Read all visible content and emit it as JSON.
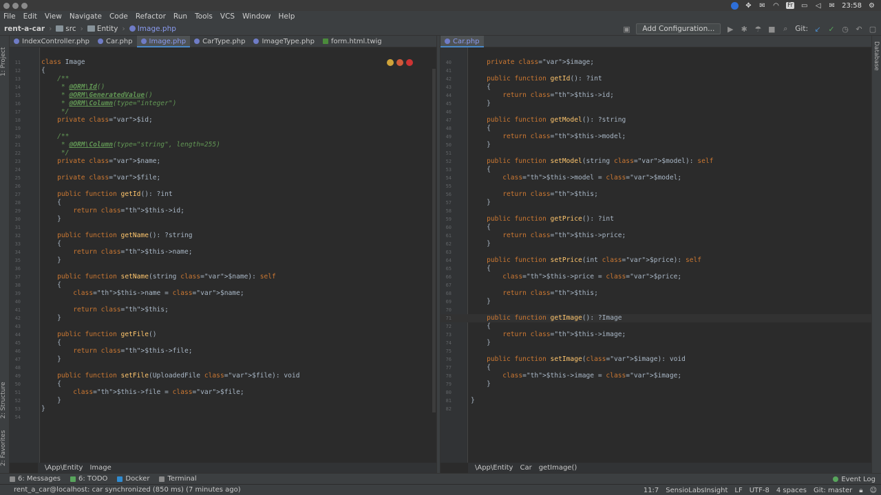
{
  "system": {
    "clock": "23:58",
    "keyboard": "Fr"
  },
  "menu": [
    "File",
    "Edit",
    "View",
    "Navigate",
    "Code",
    "Refactor",
    "Run",
    "Tools",
    "VCS",
    "Window",
    "Help"
  ],
  "nav": {
    "project": "rent-a-car",
    "crumbs": [
      "src",
      "Entity",
      "Image.php"
    ],
    "add_config": "Add Configuration...",
    "git_label": "Git:"
  },
  "tabs_left": [
    {
      "label": "IndexController.php",
      "active": false,
      "kind": "php"
    },
    {
      "label": "Car.php",
      "active": false,
      "kind": "php"
    },
    {
      "label": "Image.php",
      "active": true,
      "kind": "php"
    },
    {
      "label": "CarType.php",
      "active": false,
      "kind": "php"
    },
    {
      "label": "ImageType.php",
      "active": false,
      "kind": "php"
    },
    {
      "label": "form.html.twig",
      "active": false,
      "kind": "twig"
    }
  ],
  "tabs_right": [
    {
      "label": "Car.php",
      "active": true,
      "kind": "php"
    }
  ],
  "left_strip": [
    "1: Project",
    "2: Structure",
    "2: Favorites"
  ],
  "right_strip": "Database",
  "left_code": [
    {
      "n": "11",
      "t": "class Image",
      "cls": "cls"
    },
    {
      "n": "12",
      "t": "{"
    },
    {
      "n": "13",
      "t": "    /**",
      "cls": "cm"
    },
    {
      "n": "14",
      "t": "     * @ORM\\Id()",
      "cls": "ann"
    },
    {
      "n": "15",
      "t": "     * @ORM\\GeneratedValue()",
      "cls": "ann"
    },
    {
      "n": "16",
      "t": "     * @ORM\\Column(type=\"integer\")",
      "cls": "ann"
    },
    {
      "n": "17",
      "t": "     */",
      "cls": "cm"
    },
    {
      "n": "18",
      "t": "    private $id;",
      "cls": "prop"
    },
    {
      "n": "19",
      "t": ""
    },
    {
      "n": "20",
      "t": "    /**",
      "cls": "cm"
    },
    {
      "n": "21",
      "t": "     * @ORM\\Column(type=\"string\", length=255)",
      "cls": "ann"
    },
    {
      "n": "22",
      "t": "     */",
      "cls": "cm"
    },
    {
      "n": "23",
      "t": "    private $name;",
      "cls": "prop"
    },
    {
      "n": "24",
      "t": ""
    },
    {
      "n": "25",
      "t": "    private $file;",
      "cls": "prop"
    },
    {
      "n": "26",
      "t": ""
    },
    {
      "n": "27",
      "t": "    public function getId(): ?int",
      "cls": "fn"
    },
    {
      "n": "28",
      "t": "    {"
    },
    {
      "n": "29",
      "t": "        return $this->id;",
      "cls": "ret"
    },
    {
      "n": "30",
      "t": "    }"
    },
    {
      "n": "31",
      "t": ""
    },
    {
      "n": "32",
      "t": "    public function getName(): ?string",
      "cls": "fn"
    },
    {
      "n": "33",
      "t": "    {"
    },
    {
      "n": "34",
      "t": "        return $this->name;",
      "cls": "ret"
    },
    {
      "n": "35",
      "t": "    }"
    },
    {
      "n": "36",
      "t": ""
    },
    {
      "n": "37",
      "t": "    public function setName(string $name): self",
      "cls": "fn"
    },
    {
      "n": "38",
      "t": "    {"
    },
    {
      "n": "39",
      "t": "        $this->name = $name;",
      "cls": "asg"
    },
    {
      "n": "40",
      "t": ""
    },
    {
      "n": "41",
      "t": "        return $this;",
      "cls": "ret"
    },
    {
      "n": "42",
      "t": "    }"
    },
    {
      "n": "43",
      "t": ""
    },
    {
      "n": "44",
      "t": "    public function getFile()",
      "cls": "fn"
    },
    {
      "n": "45",
      "t": "    {"
    },
    {
      "n": "46",
      "t": "        return $this->file;",
      "cls": "ret"
    },
    {
      "n": "47",
      "t": "    }"
    },
    {
      "n": "48",
      "t": ""
    },
    {
      "n": "49",
      "t": "    public function setFile(UploadedFile $file): void",
      "cls": "fn"
    },
    {
      "n": "50",
      "t": "    {"
    },
    {
      "n": "51",
      "t": "        $this->file = $file;",
      "cls": "asg"
    },
    {
      "n": "52",
      "t": "    }"
    },
    {
      "n": "53",
      "t": "}"
    },
    {
      "n": "54",
      "t": ""
    }
  ],
  "right_code": [
    {
      "n": "40",
      "t": "    private $image;",
      "cls": "prop"
    },
    {
      "n": "41",
      "t": ""
    },
    {
      "n": "42",
      "t": "    public function getId(): ?int",
      "cls": "fn"
    },
    {
      "n": "43",
      "t": "    {"
    },
    {
      "n": "44",
      "t": "        return $this->id;",
      "cls": "ret"
    },
    {
      "n": "45",
      "t": "    }"
    },
    {
      "n": "46",
      "t": ""
    },
    {
      "n": "47",
      "t": "    public function getModel(): ?string",
      "cls": "fn"
    },
    {
      "n": "48",
      "t": "    {"
    },
    {
      "n": "49",
      "t": "        return $this->model;",
      "cls": "ret"
    },
    {
      "n": "50",
      "t": "    }"
    },
    {
      "n": "51",
      "t": ""
    },
    {
      "n": "52",
      "t": "    public function setModel(string $model): self",
      "cls": "fn"
    },
    {
      "n": "53",
      "t": "    {"
    },
    {
      "n": "54",
      "t": "        $this->model = $model;",
      "cls": "asg"
    },
    {
      "n": "55",
      "t": ""
    },
    {
      "n": "56",
      "t": "        return $this;",
      "cls": "ret"
    },
    {
      "n": "57",
      "t": "    }"
    },
    {
      "n": "58",
      "t": ""
    },
    {
      "n": "59",
      "t": "    public function getPrice(): ?int",
      "cls": "fn"
    },
    {
      "n": "60",
      "t": "    {"
    },
    {
      "n": "61",
      "t": "        return $this->price;",
      "cls": "ret"
    },
    {
      "n": "62",
      "t": "    }"
    },
    {
      "n": "63",
      "t": ""
    },
    {
      "n": "64",
      "t": "    public function setPrice(int $price): self",
      "cls": "fn"
    },
    {
      "n": "65",
      "t": "    {"
    },
    {
      "n": "66",
      "t": "        $this->price = $price;",
      "cls": "asg"
    },
    {
      "n": "67",
      "t": ""
    },
    {
      "n": "68",
      "t": "        return $this;",
      "cls": "ret"
    },
    {
      "n": "69",
      "t": "    }"
    },
    {
      "n": "70",
      "t": ""
    },
    {
      "n": "71",
      "t": "    public function getImage(): ?Image",
      "cls": "fn",
      "current": true
    },
    {
      "n": "72",
      "t": "    {"
    },
    {
      "n": "73",
      "t": "        return $this->image;",
      "cls": "ret"
    },
    {
      "n": "74",
      "t": "    }"
    },
    {
      "n": "75",
      "t": ""
    },
    {
      "n": "76",
      "t": "    public function setImage($image): void",
      "cls": "fn"
    },
    {
      "n": "77",
      "t": "    {"
    },
    {
      "n": "78",
      "t": "        $this->image = $image;",
      "cls": "asg"
    },
    {
      "n": "79",
      "t": "    }"
    },
    {
      "n": "80",
      "t": ""
    },
    {
      "n": "81",
      "t": "}"
    },
    {
      "n": "82",
      "t": ""
    }
  ],
  "bread_left": [
    "\\App\\Entity",
    "Image"
  ],
  "bread_right": [
    "\\App\\Entity",
    "Car",
    "getImage()"
  ],
  "tool_windows": [
    {
      "label": "6: Messages",
      "icon": "messages"
    },
    {
      "label": "6: TODO",
      "icon": "todo"
    },
    {
      "label": "Docker",
      "icon": "docker"
    },
    {
      "label": "Terminal",
      "icon": "terminal"
    }
  ],
  "event_log": "Event Log",
  "status": {
    "message": "rent_a_car@localhost: car synchronized (850 ms) (7 minutes ago)",
    "position": "11:7",
    "inspector": "SensioLabsInsight",
    "line_sep": "LF",
    "encoding": "UTF-8",
    "indent": "4 spaces",
    "git_branch": "Git: master"
  }
}
